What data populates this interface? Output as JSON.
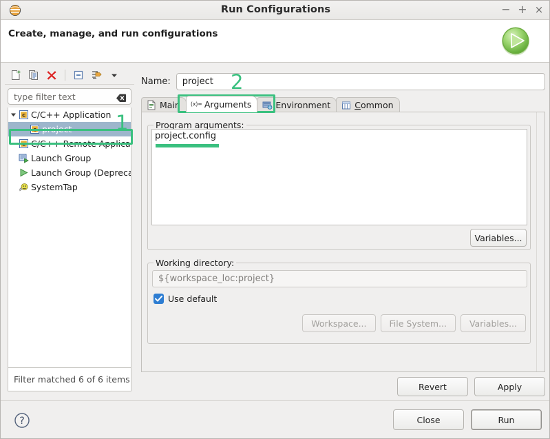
{
  "window": {
    "title": "Run Configurations",
    "app_icon": "eclipse-icon",
    "minimize_label": "−",
    "maximize_label": "+",
    "close_label": "×"
  },
  "header": {
    "title": "Create, manage, and run configurations",
    "icon": "run-green-play-icon"
  },
  "left_panel": {
    "toolbar": [
      {
        "name": "new-launch-configuration-icon",
        "title": "New launch configuration"
      },
      {
        "name": "duplicate-icon",
        "title": "Duplicate"
      },
      {
        "name": "delete-icon",
        "title": "Delete"
      },
      {
        "name": "collapse-all-icon",
        "title": "Collapse All"
      },
      {
        "name": "filter-icon",
        "title": "Filter launch configurations"
      },
      {
        "name": "view-menu-chevron-icon",
        "title": "View Menu"
      }
    ],
    "filter": {
      "placeholder": "type filter text",
      "clear_icon": "clear-field-icon"
    },
    "tree": [
      {
        "label": "C/C++ Application",
        "icon": "c-application-icon",
        "expanded": true,
        "depth": 0,
        "selected": false
      },
      {
        "label": "project",
        "icon": "c-application-icon",
        "depth": 1,
        "selected": true
      },
      {
        "label": "C/C++ Remote Application",
        "icon": "c-application-icon",
        "depth": 0,
        "selected": false
      },
      {
        "label": "Launch Group",
        "icon": "launch-group-icon",
        "depth": 0,
        "selected": false
      },
      {
        "label": "Launch Group (Deprecated)",
        "icon": "launch-group-deprecated-icon",
        "depth": 0,
        "selected": false
      },
      {
        "label": "SystemTap",
        "icon": "systemtap-icon",
        "depth": 0,
        "selected": false
      }
    ],
    "status": "Filter matched 6 of 6 items"
  },
  "right_panel": {
    "name_label": "Name:",
    "name_value": "project",
    "tabs": [
      {
        "label": "Main",
        "icon": "main-document-icon",
        "active": false,
        "underline_index": -1
      },
      {
        "label": "Arguments",
        "icon": "arguments-xeq-icon",
        "active": true,
        "underline_index": -1
      },
      {
        "label": "Environment",
        "icon": "environment-icon",
        "active": false,
        "underline_index": -1
      },
      {
        "label": "Common",
        "icon": "common-table-icon",
        "active": false,
        "underline_index": 0
      }
    ],
    "program_arguments": {
      "group_title": "Program arguments:",
      "value": "project.config",
      "variables_button": "Variables..."
    },
    "working_directory": {
      "group_title": "Working directory:",
      "value": "${workspace_loc:project}",
      "use_default_label": "Use default",
      "use_default_checked": true,
      "buttons": [
        {
          "label": "Workspace...",
          "disabled": true
        },
        {
          "label": "File System...",
          "disabled": true
        },
        {
          "label": "Variables...",
          "disabled": true
        }
      ]
    },
    "revert_button": "Revert",
    "apply_button": "Apply"
  },
  "bottom": {
    "help_icon": "help-question-icon",
    "close_button": "Close",
    "run_button": "Run"
  },
  "annotations": [
    {
      "id": 1,
      "number": "1",
      "target": "tree-item-project"
    },
    {
      "id": 2,
      "number": "2",
      "target": "tab-arguments"
    }
  ],
  "colors": {
    "annotation_green": "#3ac07f",
    "selection_blue": "#9db6cc",
    "checkbox_blue": "#2d7dd2",
    "dialog_background": "#f0efee"
  }
}
